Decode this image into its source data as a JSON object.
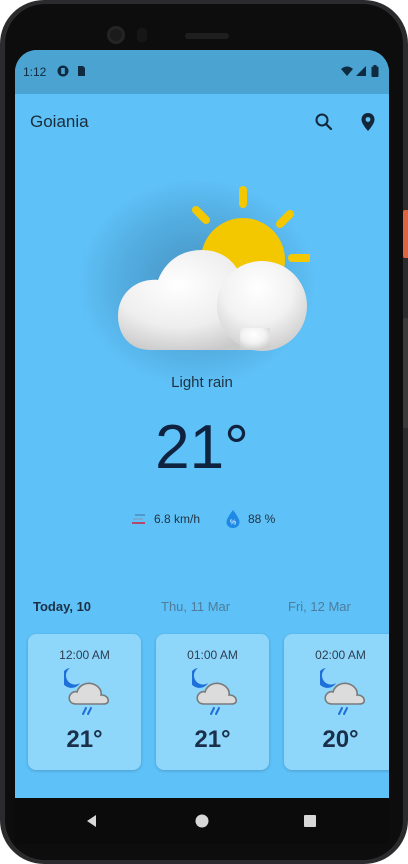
{
  "status_bar": {
    "time": "1:12"
  },
  "app_bar": {
    "city": "Goiania"
  },
  "current": {
    "condition": "Light rain",
    "temperature": "21°",
    "wind": "6.8 km/h",
    "humidity": "88 %",
    "icon": "partly-cloudy-icon"
  },
  "days": [
    {
      "label": "Today, 10",
      "active": true
    },
    {
      "label": "Thu, 11 Mar",
      "active": false
    },
    {
      "label": "Fri, 12 Mar",
      "active": false
    }
  ],
  "hourly": [
    {
      "time": "12:00 AM",
      "temp": "21°",
      "icon": "night-rain-icon"
    },
    {
      "time": "01:00 AM",
      "temp": "21°",
      "icon": "night-rain-icon"
    },
    {
      "time": "02:00 AM",
      "temp": "20°",
      "icon": "night-rain-icon"
    }
  ],
  "colors": {
    "background": "#5ec1f7",
    "status_bar": "#4ba3d2",
    "card": "#8fd6fb",
    "sun": "#f3c800",
    "accent_blue": "#1e88e5"
  }
}
